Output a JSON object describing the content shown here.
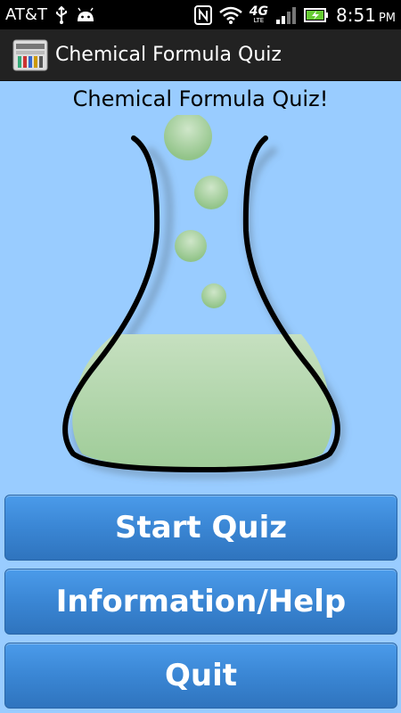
{
  "status_bar": {
    "carrier": "AT&T",
    "network_label": "4G",
    "network_sub": "LTE",
    "time": "8:51",
    "ampm": "PM",
    "battery_color": "#66cc33"
  },
  "action_bar": {
    "title": "Chemical Formula Quiz"
  },
  "main": {
    "title": "Chemical Formula Quiz!",
    "liquid_color": "#b8d8b2",
    "bubble_color": "#a9d2a0",
    "buttons": {
      "start": "Start Quiz",
      "info": "Information/Help",
      "quit": "Quit"
    }
  },
  "colors": {
    "background": "#99ccff",
    "button": "#3a86d4"
  }
}
